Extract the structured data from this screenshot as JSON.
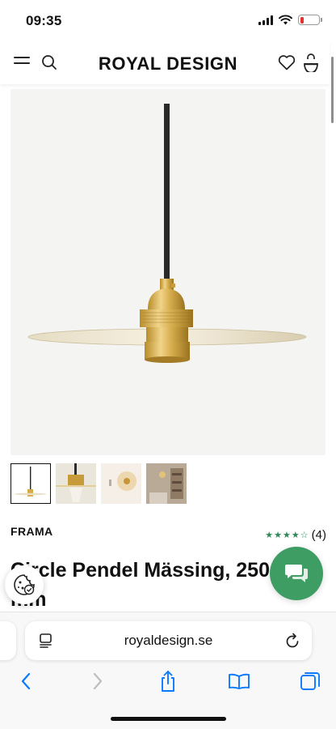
{
  "status_bar": {
    "time": "09:35"
  },
  "header": {
    "brand": "ROYAL DESIGN"
  },
  "product": {
    "brand": "FRAMA",
    "rating_count": "(4)",
    "rating_stars": 4,
    "title_line1": "Circle Pendel Mässing, 250",
    "title_line2": "mm"
  },
  "browser": {
    "url": "royaldesign.se"
  },
  "colors": {
    "accent_green": "#3d9d63",
    "star_green": "#2e8b57",
    "battery_red": "#e5322d",
    "ios_blue": "#0a7aff"
  },
  "icons": [
    "menu-icon",
    "search-icon",
    "heart-icon",
    "shopping-bag-icon",
    "cookie-icon",
    "chat-icon",
    "reader-icon",
    "reload-icon",
    "back-icon",
    "forward-icon",
    "share-icon",
    "bookmarks-icon",
    "tabs-icon"
  ]
}
